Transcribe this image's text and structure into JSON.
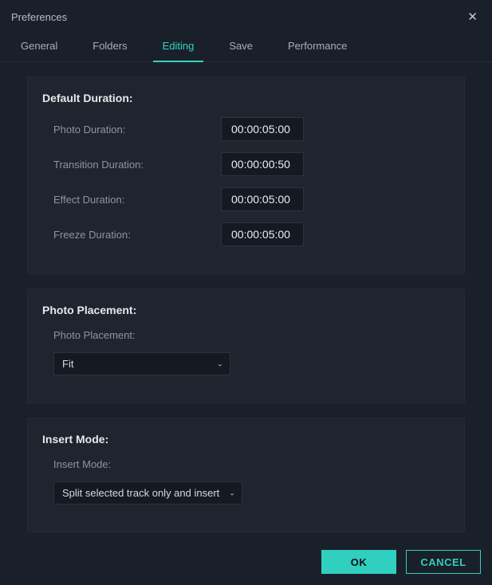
{
  "window": {
    "title": "Preferences"
  },
  "tabs": {
    "general": "General",
    "folders": "Folders",
    "editing": "Editing",
    "save": "Save",
    "performance": "Performance"
  },
  "sections": {
    "default_duration": {
      "title": "Default Duration:",
      "rows": {
        "photo": {
          "label": "Photo Duration:",
          "value": "00:00:05:00"
        },
        "transition": {
          "label": "Transition Duration:",
          "value": "00:00:00:50"
        },
        "effect": {
          "label": "Effect Duration:",
          "value": "00:00:05:00"
        },
        "freeze": {
          "label": "Freeze Duration:",
          "value": "00:00:05:00"
        }
      }
    },
    "photo_placement": {
      "title": "Photo Placement:",
      "label": "Photo Placement:",
      "value": "Fit"
    },
    "insert_mode": {
      "title": "Insert Mode:",
      "label": "Insert Mode:",
      "value": "Split selected track only and insert"
    }
  },
  "buttons": {
    "ok": "OK",
    "cancel": "CANCEL"
  }
}
